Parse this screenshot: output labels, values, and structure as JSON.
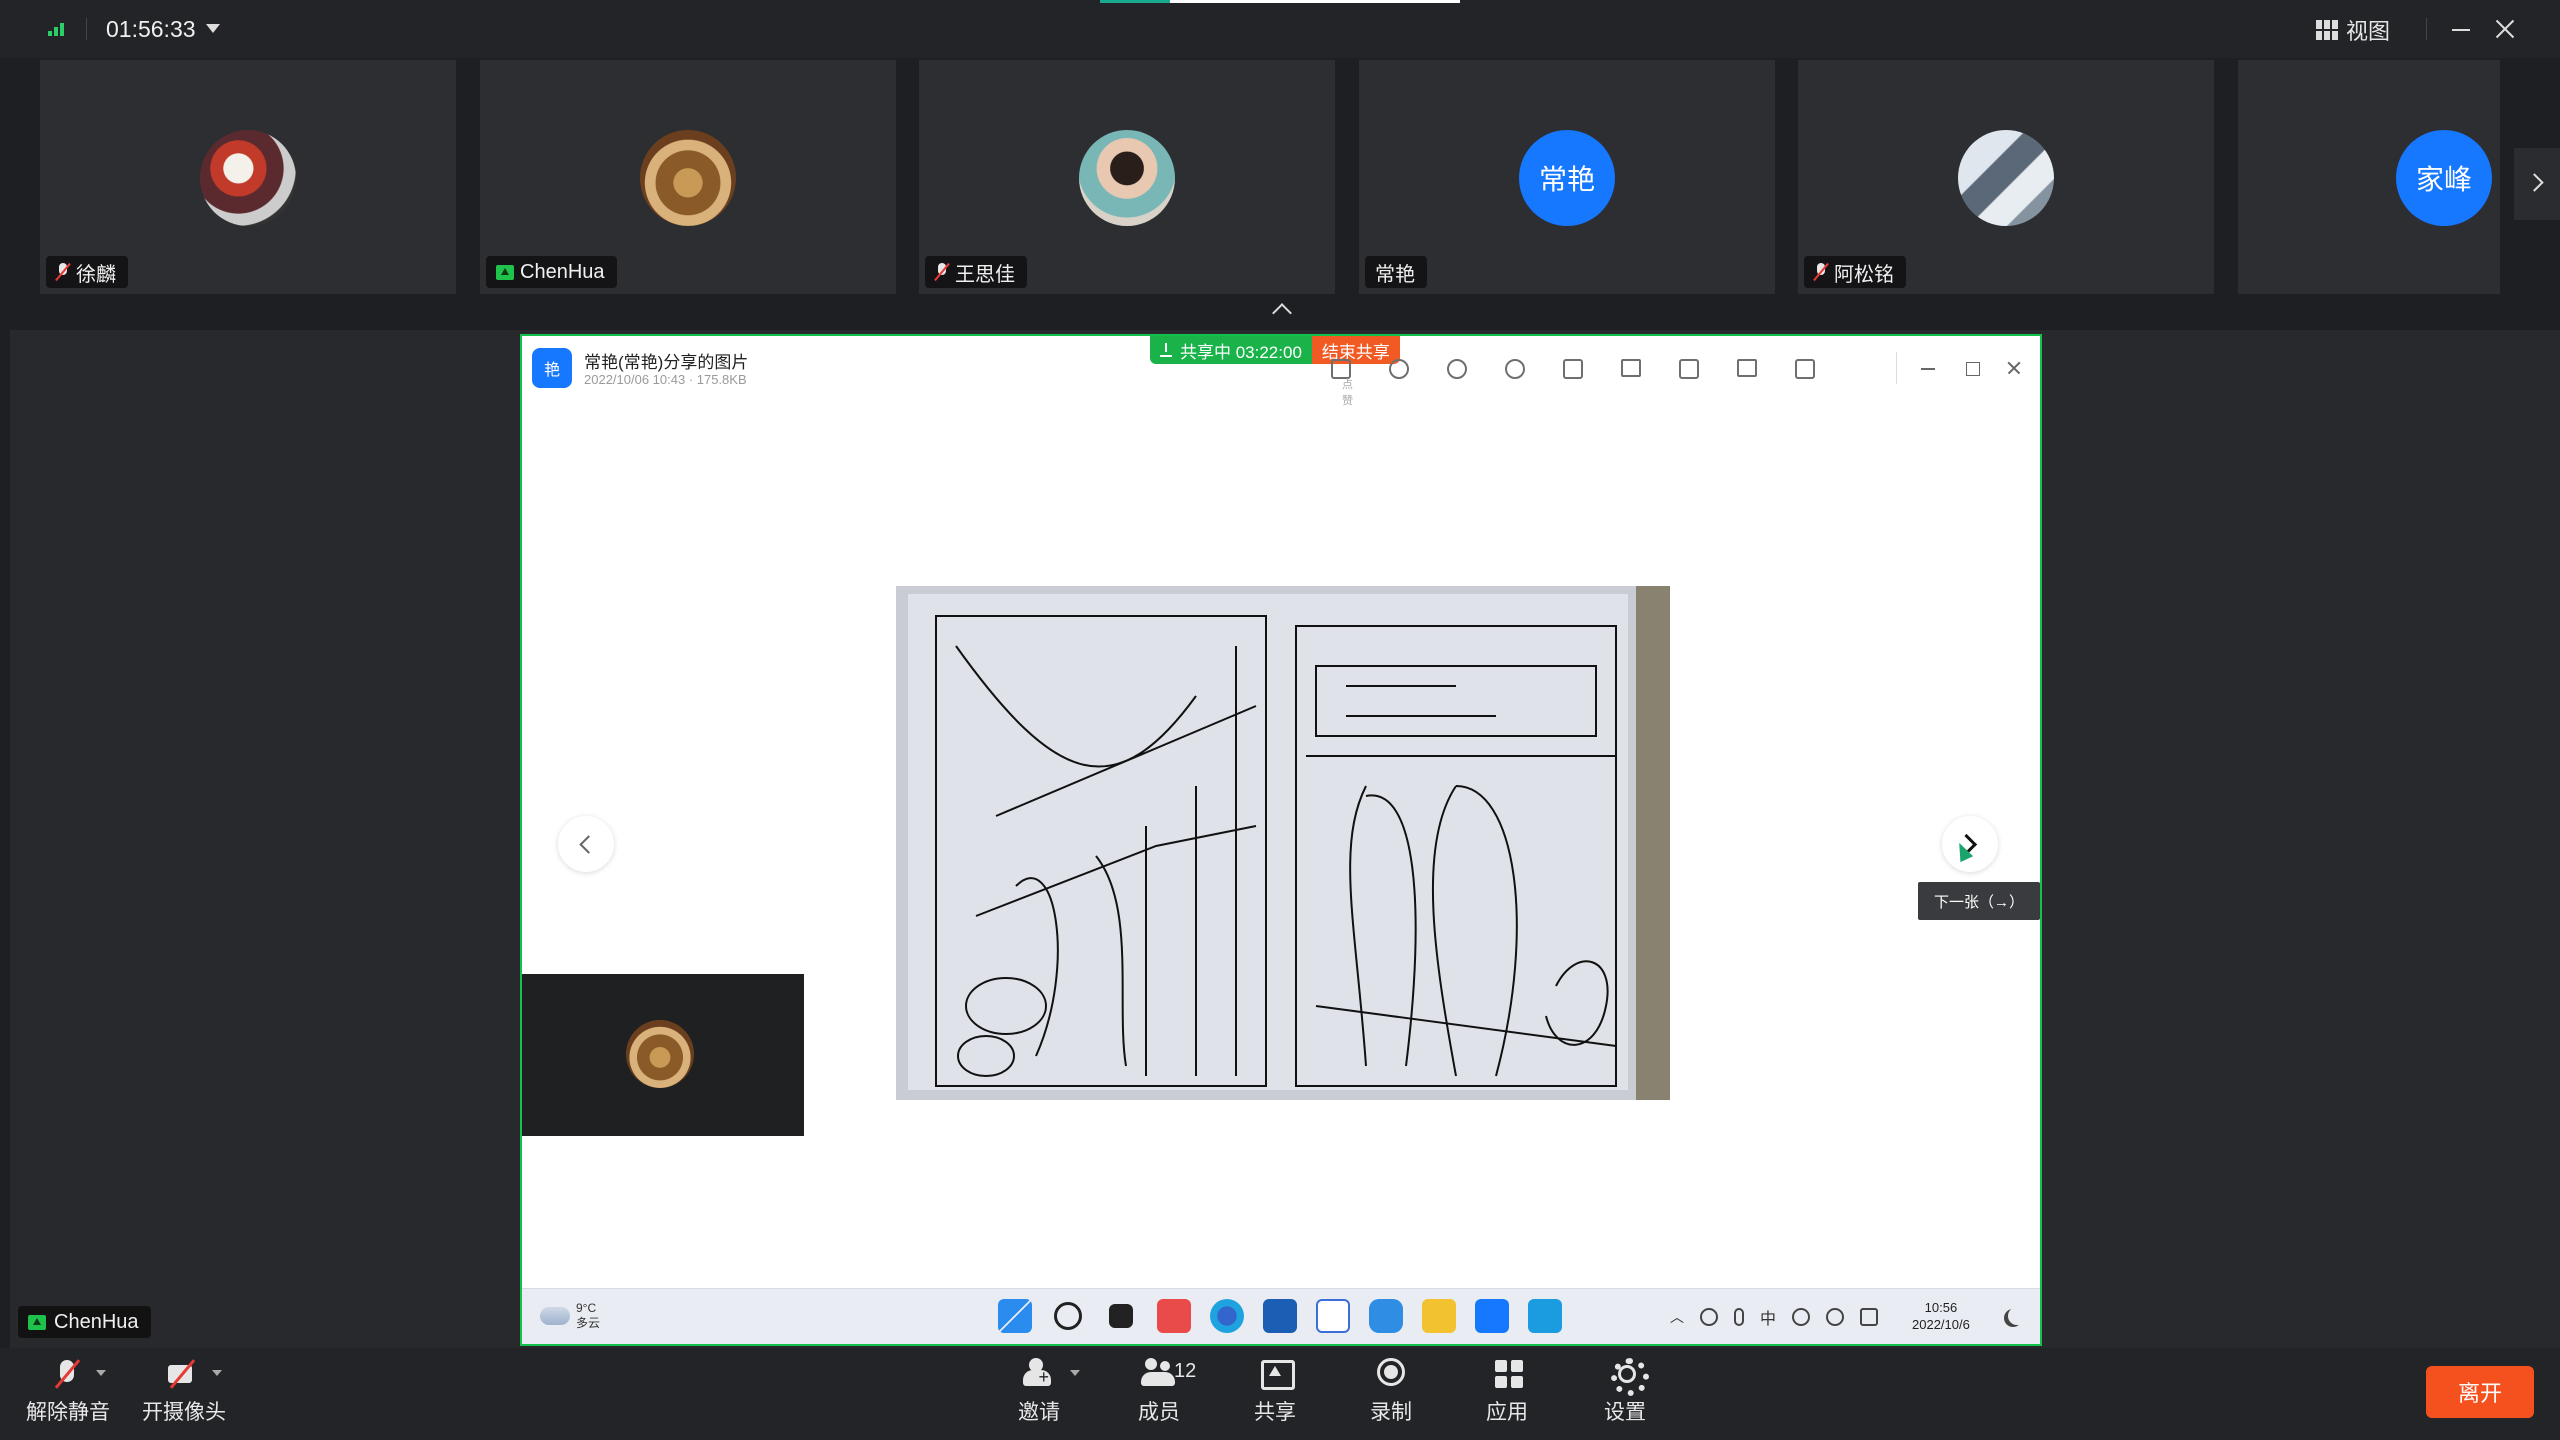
{
  "topbar": {
    "timer": "01:56:33",
    "view_label": "视图",
    "icons": [
      "signal-icon",
      "chevron-down-icon",
      "grid-view-icon",
      "minimize-icon",
      "close-icon"
    ]
  },
  "participants": [
    {
      "name": "徐麟",
      "muted": true,
      "avatar": "photo"
    },
    {
      "name": "ChenHua",
      "muted": false,
      "sharing": true,
      "avatar": "photo"
    },
    {
      "name": "王思佳",
      "muted": true,
      "avatar": "photo"
    },
    {
      "name": "常艳",
      "muted": false,
      "avatar_text": "常艳"
    },
    {
      "name": "阿松铭",
      "muted": true,
      "avatar": "photo"
    },
    {
      "name": "家峰",
      "muted": false,
      "avatar_text": "家峰"
    }
  ],
  "share": {
    "viewer_logo": "艳",
    "viewer_title": "常艳(常艳)分享的图片",
    "viewer_meta": "2022/10/06 10:43 · 175.8KB",
    "status_text": "共享中 03:22:00",
    "end_label": "结束共享",
    "tool_note": "点赞",
    "tooltip": "下一张（→）",
    "colors": {
      "share_border": "#12c24b",
      "status_green": "#19b34a",
      "end_red": "#f15a22"
    }
  },
  "taskbar": {
    "temp": "9°C",
    "weather": "多云",
    "ime": "中",
    "time": "10:56",
    "date": "2022/10/6"
  },
  "presenter": {
    "name": "ChenHua"
  },
  "toolbar": {
    "unmute": "解除静音",
    "camera": "开摄像头",
    "invite": "邀请",
    "members": "成员",
    "members_count": "12",
    "share": "共享",
    "record": "录制",
    "apps": "应用",
    "settings": "设置",
    "leave": "离开",
    "leave_color": "#f4511e"
  }
}
